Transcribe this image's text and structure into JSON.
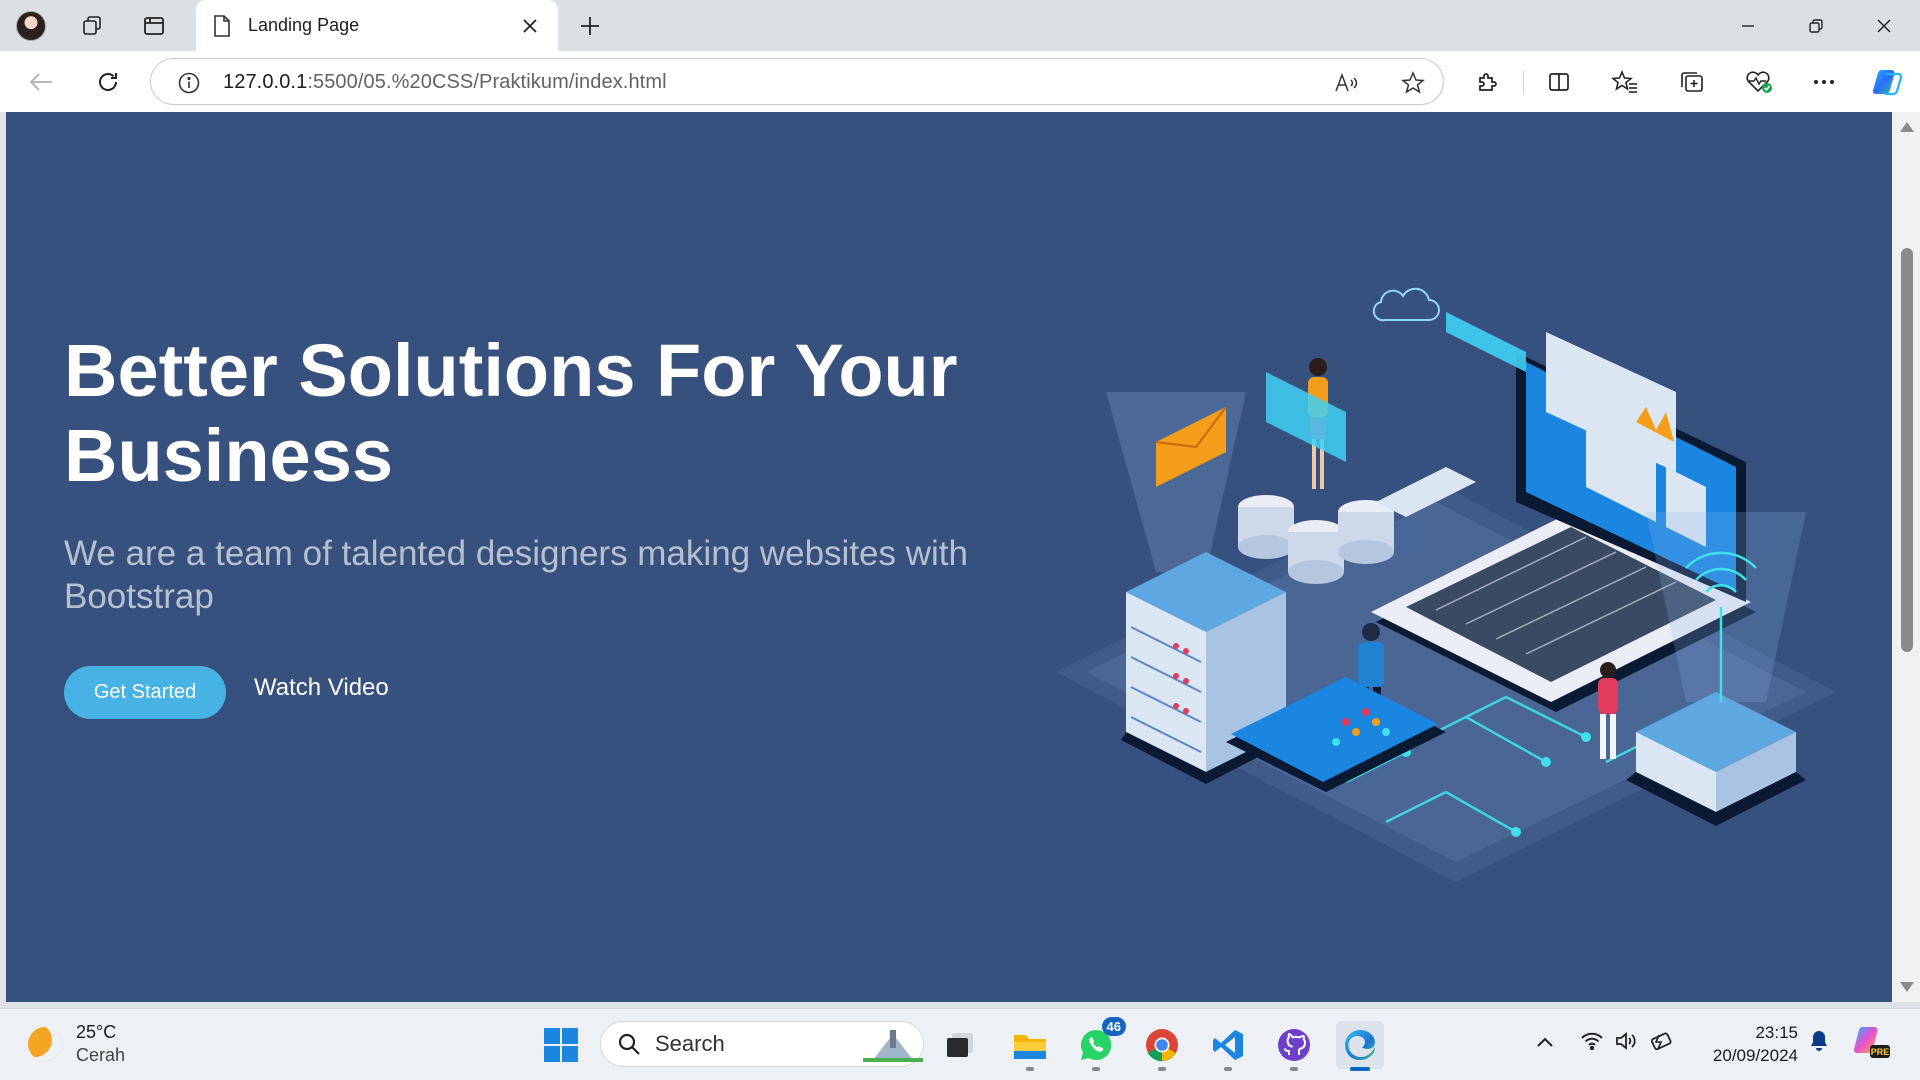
{
  "browser": {
    "tab_title": "Landing Page",
    "url_host": "127.0.0.1",
    "url_rest": ":5500/05.%20CSS/Praktikum/index.html"
  },
  "hero": {
    "title": "Better Solutions For Your Business",
    "subtitle": "We are a team of talented designers making websites with Bootstrap",
    "primary_button": "Get Started",
    "secondary_link": "Watch Video"
  },
  "colors": {
    "page_bg": "#37517e",
    "accent": "#47b2e4",
    "subtitle": "#b7c0cf"
  },
  "taskbar": {
    "weather_temp": "25°C",
    "weather_condition": "Cerah",
    "search_label": "Search",
    "whatsapp_badge": "46",
    "time": "23:15",
    "date": "20/09/2024"
  },
  "icons": [
    "profile-avatar",
    "collections-icon",
    "tab-actions-icon",
    "page-icon",
    "close-icon",
    "plus-icon",
    "back-icon",
    "refresh-icon",
    "info-icon",
    "read-aloud-icon",
    "star-icon",
    "extensions-icon",
    "split-screen-icon",
    "favorites-icon",
    "collections-icon",
    "browser-essentials-icon",
    "more-icon",
    "copilot-icon",
    "windows-start-icon",
    "search-icon",
    "task-view-icon",
    "file-explorer-icon",
    "whatsapp-icon",
    "chrome-icon",
    "vscode-icon",
    "github-icon",
    "edge-icon",
    "chevron-up-icon",
    "wifi-icon",
    "volume-icon",
    "battery-icon",
    "bell-icon",
    "copilot-pre-icon"
  ]
}
